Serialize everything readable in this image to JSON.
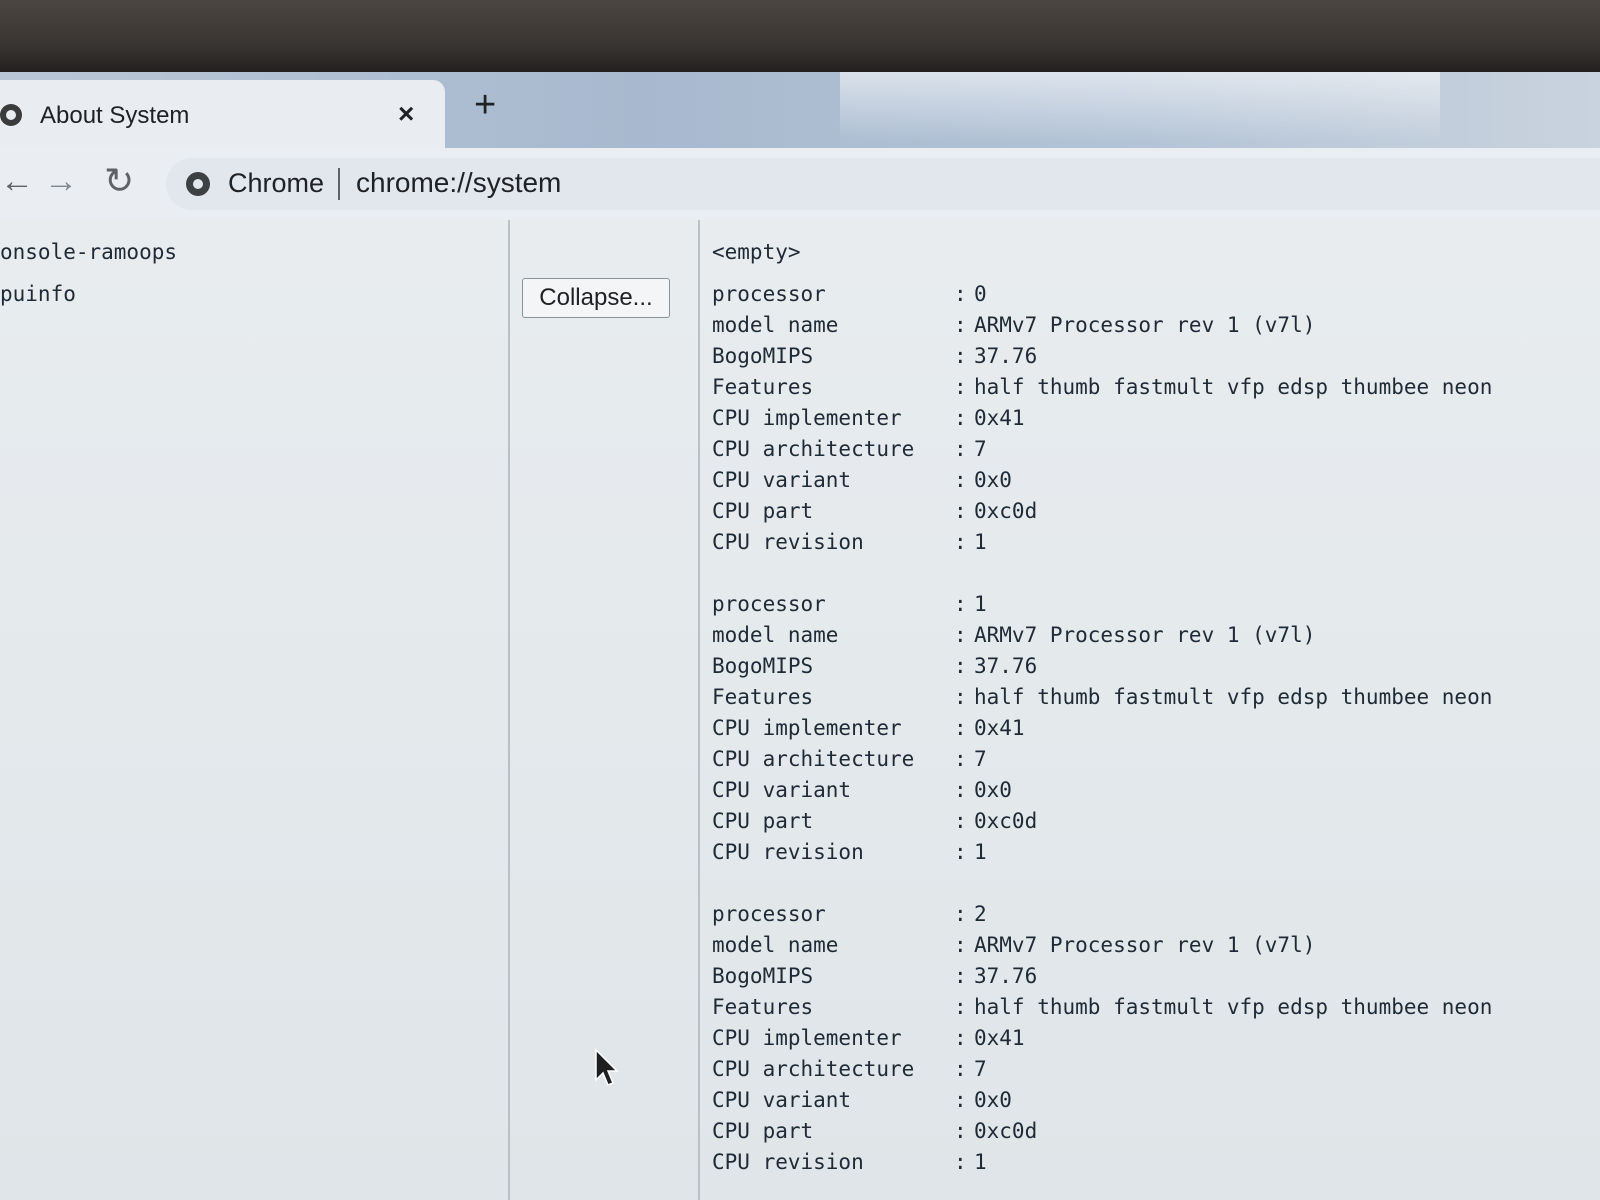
{
  "tab": {
    "title": "About System",
    "close_glyph": "×",
    "new_tab_glyph": "+"
  },
  "toolbar": {
    "back_glyph": "←",
    "forward_glyph": "→",
    "reload_glyph": "↻",
    "chip_label": "Chrome",
    "url": "chrome://system"
  },
  "left_rows": [
    {
      "name": "onsole-ramoops"
    },
    {
      "name": "puinfo"
    }
  ],
  "collapse_label": "Collapse...",
  "console_ramoops_value": "<empty>",
  "cpuinfo": [
    [
      {
        "key": "processor",
        "val": "0"
      },
      {
        "key": "model name",
        "val": "ARMv7 Processor rev 1 (v7l)"
      },
      {
        "key": "BogoMIPS",
        "val": "37.76"
      },
      {
        "key": "Features",
        "val": "half thumb fastmult vfp edsp thumbee neon"
      },
      {
        "key": "CPU implementer",
        "val": "0x41"
      },
      {
        "key": "CPU architecture",
        "val": "7"
      },
      {
        "key": "CPU variant",
        "val": "0x0"
      },
      {
        "key": "CPU part",
        "val": "0xc0d"
      },
      {
        "key": "CPU revision",
        "val": "1"
      }
    ],
    [
      {
        "key": "processor",
        "val": "1"
      },
      {
        "key": "model name",
        "val": "ARMv7 Processor rev 1 (v7l)"
      },
      {
        "key": "BogoMIPS",
        "val": "37.76"
      },
      {
        "key": "Features",
        "val": "half thumb fastmult vfp edsp thumbee neon"
      },
      {
        "key": "CPU implementer",
        "val": "0x41"
      },
      {
        "key": "CPU architecture",
        "val": "7"
      },
      {
        "key": "CPU variant",
        "val": "0x0"
      },
      {
        "key": "CPU part",
        "val": "0xc0d"
      },
      {
        "key": "CPU revision",
        "val": "1"
      }
    ],
    [
      {
        "key": "processor",
        "val": "2"
      },
      {
        "key": "model name",
        "val": "ARMv7 Processor rev 1 (v7l)"
      },
      {
        "key": "BogoMIPS",
        "val": "37.76"
      },
      {
        "key": "Features",
        "val": "half thumb fastmult vfp edsp thumbee neon"
      },
      {
        "key": "CPU implementer",
        "val": "0x41"
      },
      {
        "key": "CPU architecture",
        "val": "7"
      },
      {
        "key": "CPU variant",
        "val": "0x0"
      },
      {
        "key": "CPU part",
        "val": "0xc0d"
      },
      {
        "key": "CPU revision",
        "val": "1"
      }
    ]
  ],
  "colors": {
    "accent": "#1a73e8",
    "text": "#1e2a36"
  },
  "icons": {
    "favicon": "globe-icon",
    "site": "chrome-icon",
    "cursor": "mouse-pointer-icon"
  }
}
